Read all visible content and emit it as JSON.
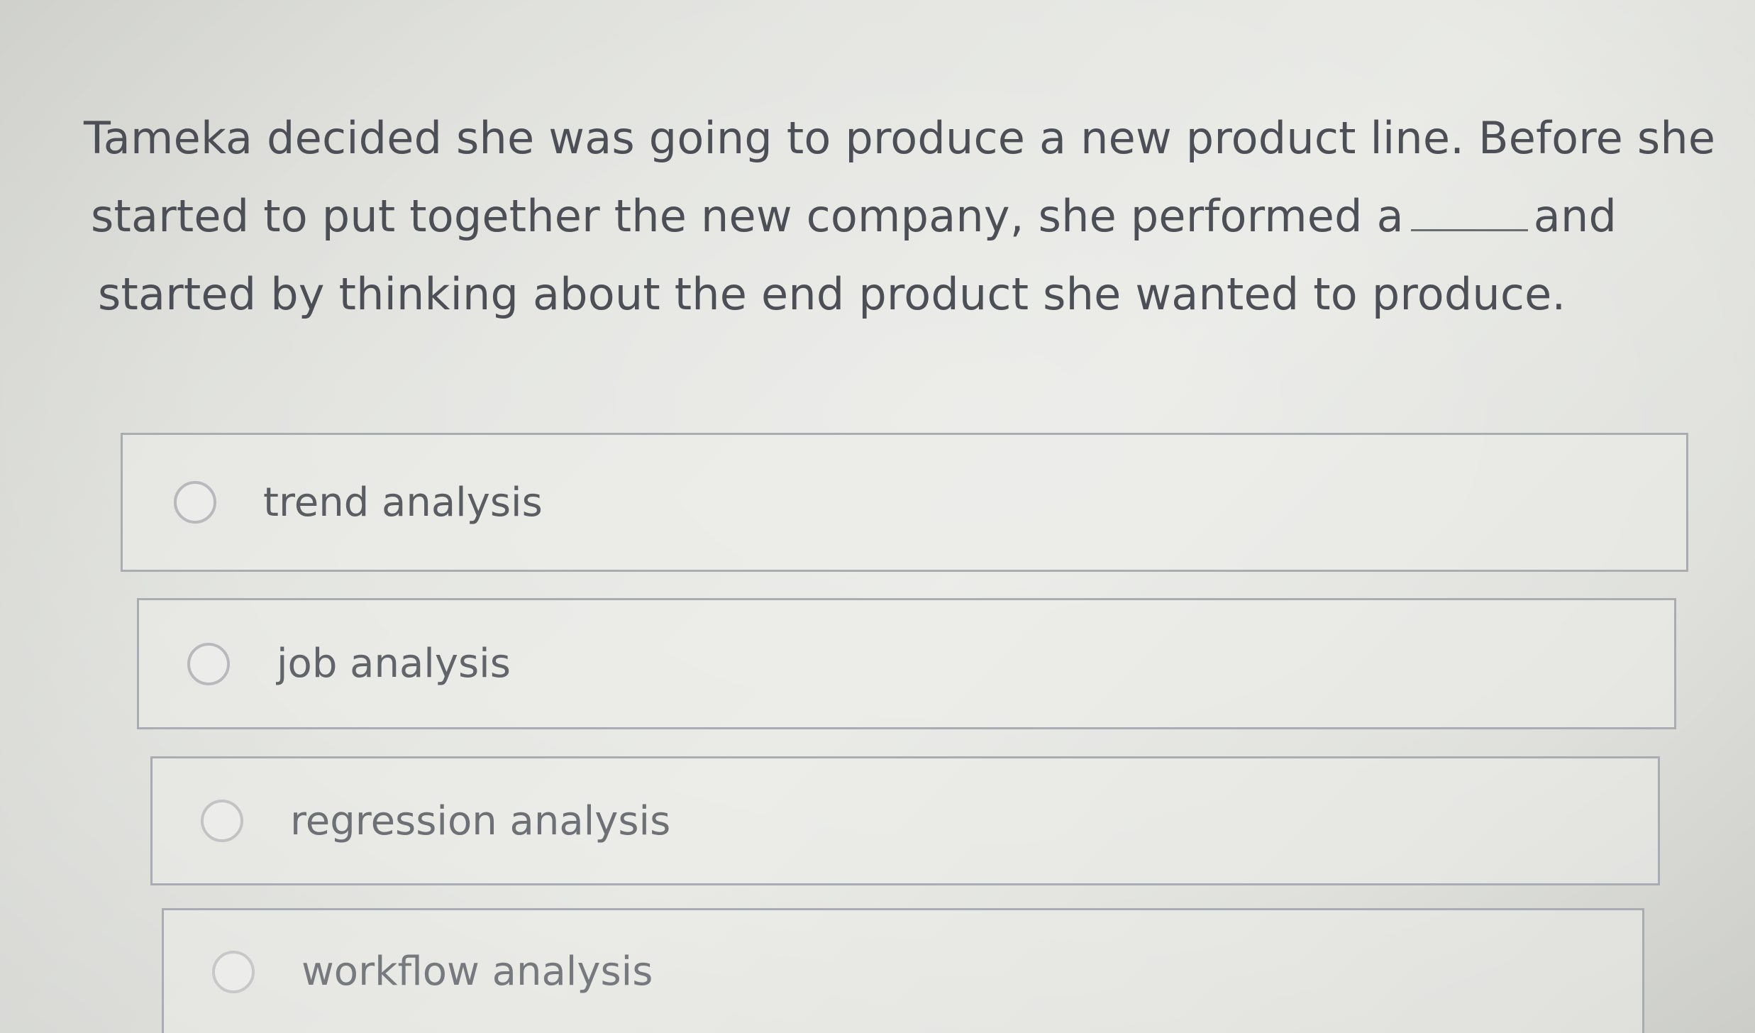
{
  "question": {
    "line1": "Tameka decided she was going to produce a new product line. Before she",
    "line2_before_blank": "started to put together the new company, she performed a",
    "line2_after_blank": "and",
    "line3": "started by thinking about the end product she wanted to produce."
  },
  "options": [
    {
      "label": "trend analysis",
      "selected": false
    },
    {
      "label": "job analysis",
      "selected": false
    },
    {
      "label": "regression analysis",
      "selected": false
    },
    {
      "label": "workflow analysis",
      "selected": false
    }
  ]
}
